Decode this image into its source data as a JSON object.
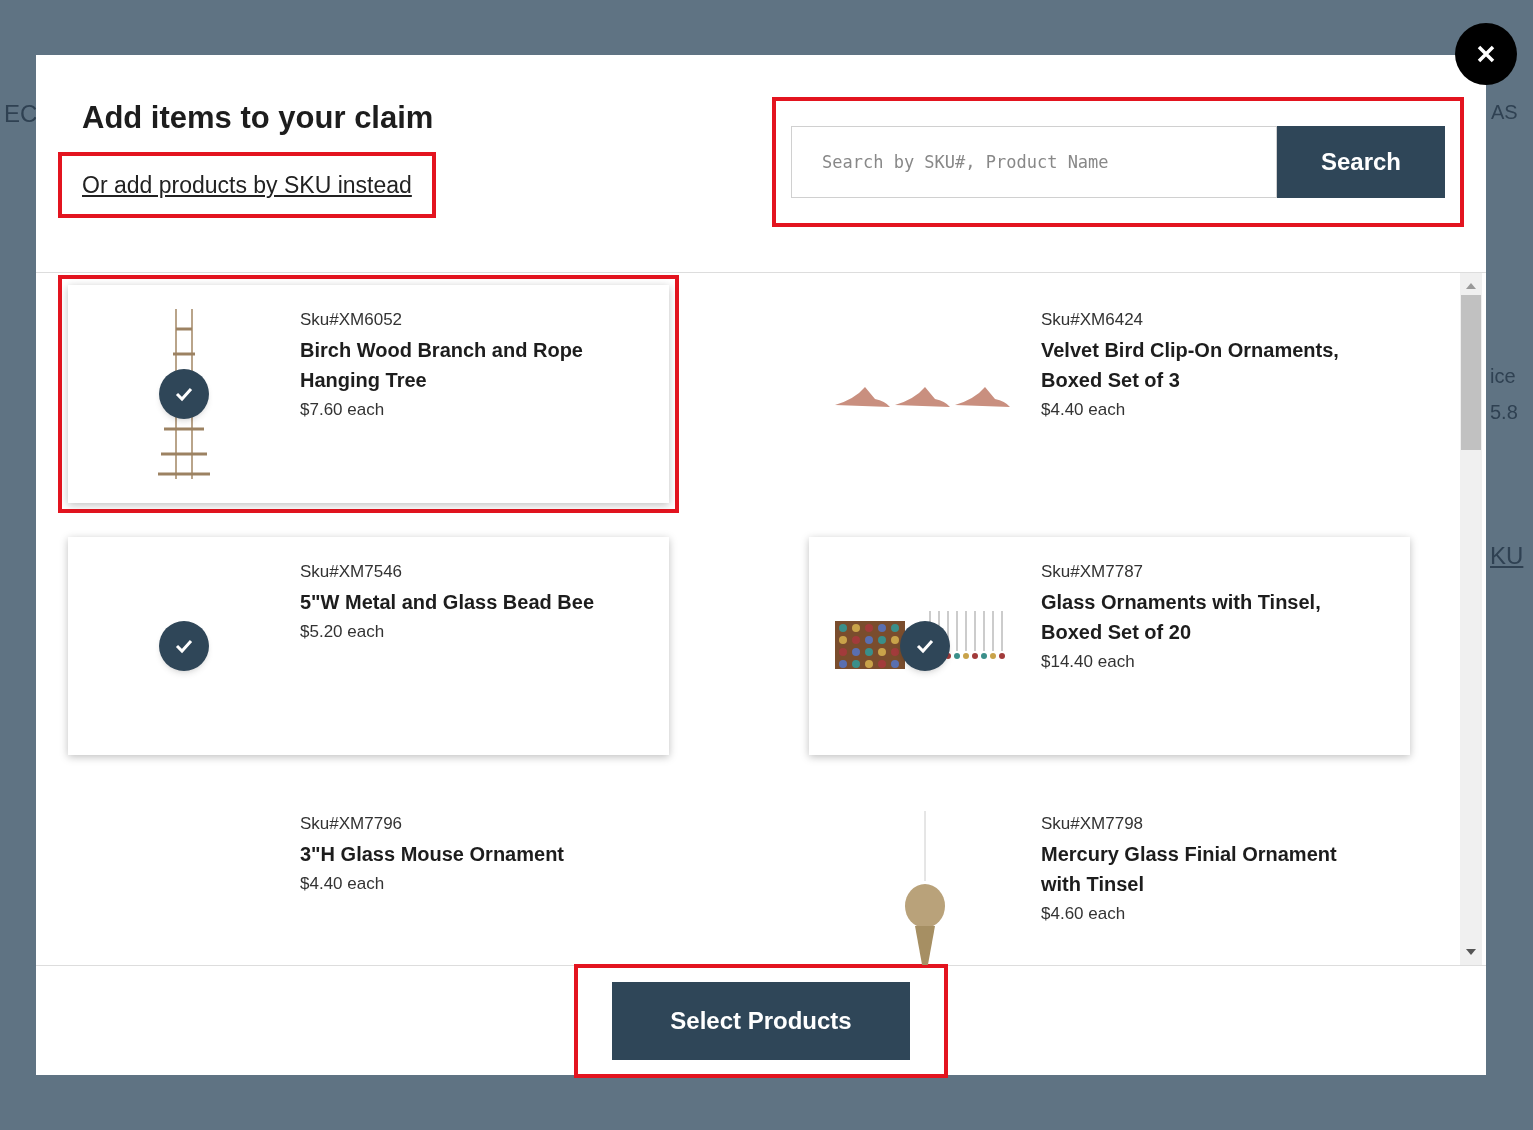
{
  "background_fragments": [
    "EC",
    "AS",
    "ice",
    "5.8",
    "KU"
  ],
  "modal": {
    "title": "Add items to your claim",
    "sku_link": {
      "text": "Or add products by SKU instead",
      "highlighted": true
    },
    "search": {
      "placeholder": "Search by SKU#, Product Name",
      "button": "Search",
      "highlighted": true
    },
    "products": [
      {
        "sku": "Sku#XM6052",
        "name": "Birch Wood Branch and Rope Hanging Tree",
        "price": "$7.60 each",
        "selected": true,
        "highlighted": true,
        "kind": "ladder"
      },
      {
        "sku": "Sku#XM6424",
        "name": "Velvet Bird Clip-On Ornaments, Boxed Set of 3",
        "price": "$4.40 each",
        "selected": false,
        "highlighted": false,
        "kind": "birds"
      },
      {
        "sku": "Sku#XM7546",
        "name": "5\"W Metal and Glass Bead Bee",
        "price": "$5.20 each",
        "selected": true,
        "highlighted": false,
        "kind": "none"
      },
      {
        "sku": "Sku#XM7787",
        "name": "Glass Ornaments with Tinsel, Boxed Set of 20",
        "price": "$14.40 each",
        "selected": true,
        "highlighted": false,
        "kind": "box"
      },
      {
        "sku": "Sku#XM7796",
        "name": "3\"H Glass Mouse Ornament",
        "price": "$4.40 each",
        "selected": false,
        "highlighted": false,
        "kind": "none"
      },
      {
        "sku": "Sku#XM7798",
        "name": "Mercury Glass Finial Ornament with Tinsel",
        "price": "$4.60 each",
        "selected": false,
        "highlighted": false,
        "kind": "finial"
      }
    ],
    "submit": {
      "text": "Select Products",
      "highlighted": true
    }
  }
}
